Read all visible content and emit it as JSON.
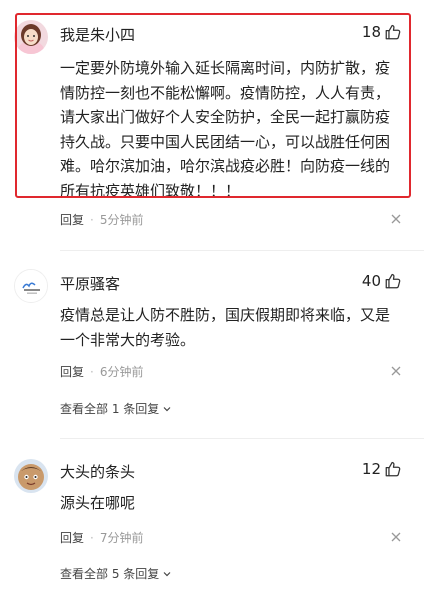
{
  "comments": [
    {
      "username": "我是朱小四",
      "likes": "18",
      "text": "一定要外防境外输入延长隔离时间，内防扩散，疫情防控一刻也不能松懈啊。疫情防控，人人有责，请大家出门做好个人安全防护，全民一起打赢防疫持久战。只要中国人民团结一心，可以战胜任何困难。哈尔滨加油，哈尔滨战疫必胜！向防疫一线的所有抗疫英雄们致敬！！！",
      "reply_label": "回复",
      "time": "5分钟前",
      "avatar_icon": "girl-avatar-icon"
    },
    {
      "username": "平原骚客",
      "likes": "40",
      "text": "疫情总是让人防不胜防，国庆假期即将来临，又是一个非常大的考验。",
      "reply_label": "回复",
      "time": "6分钟前",
      "view_all": "查看全部 1 条回复",
      "avatar_icon": "logo-avatar-icon"
    },
    {
      "username": "大头的条头",
      "likes": "12",
      "text": "源头在哪呢",
      "reply_label": "回复",
      "time": "7分钟前",
      "view_all": "查看全部 5 条回复",
      "avatar_icon": "cartoon-face-avatar-icon"
    }
  ],
  "colors": {
    "highlight_border": "#e0282e",
    "text": "#222222",
    "meta": "#999999"
  }
}
